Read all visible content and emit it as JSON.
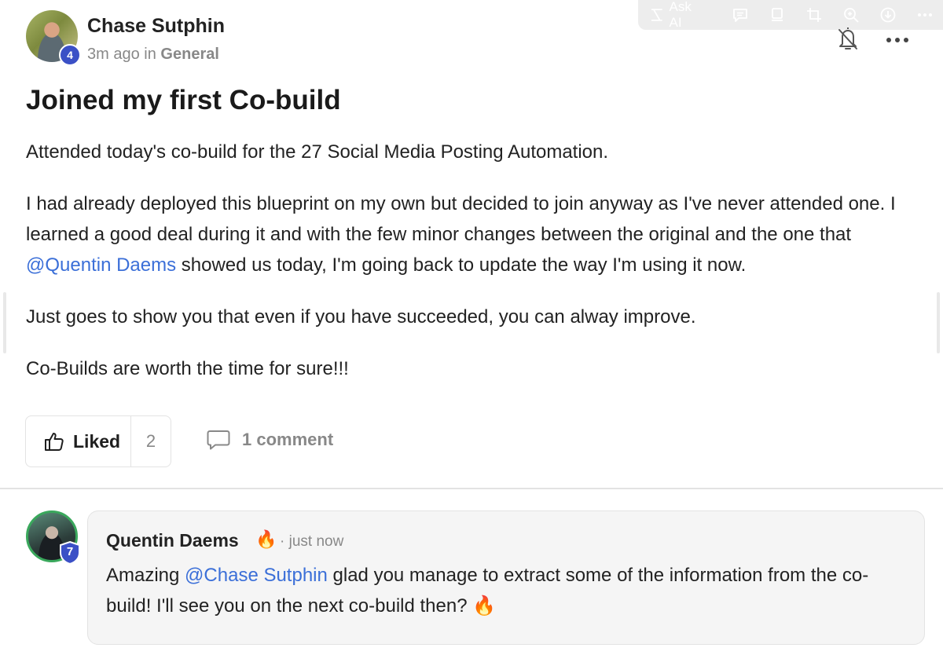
{
  "toolbar": {
    "ask_ai_label": "Ask AI",
    "icons": [
      "sparkle-icon",
      "comment-icon",
      "document-icon",
      "crop-icon",
      "zoom-icon",
      "download-icon",
      "more-icon"
    ]
  },
  "post": {
    "author": {
      "name": "Chase Sutphin",
      "level": "4"
    },
    "time": "3m ago",
    "in_label": "in",
    "channel": "General",
    "title": "Joined my first Co-build",
    "paragraphs": {
      "p1": "Attended today's co-build for the 27 Social Media Posting Automation.",
      "p2_before": "I had already deployed this blueprint on my own but decided to join anyway as I've never attended one. I learned a good deal during it and with the few minor changes between the original and the one that ",
      "p2_mention": "@Quentin Daems",
      "p2_after": " showed us today, I'm going back to update the way I'm using it now.",
      "p3": "Just goes to show you that even if you have succeeded, you can alway improve.",
      "p4": "Co-Builds are worth the time for sure!!!"
    },
    "reactions": {
      "liked_label": "Liked",
      "like_count": "2",
      "comment_label": "1 comment"
    }
  },
  "comment": {
    "author": {
      "name": "Quentin Daems",
      "level": "7"
    },
    "fire_emoji": "🔥",
    "time": "just now",
    "text_before": "Amazing ",
    "mention": "@Chase Sutphin",
    "text_after": " glad you manage to extract some of the information from the co-build! I'll see you on the next co-build then? 🔥"
  },
  "colors": {
    "accent_badge": "#3b50c6",
    "mention": "#3b6fd8",
    "ring": "#3aa85c"
  }
}
